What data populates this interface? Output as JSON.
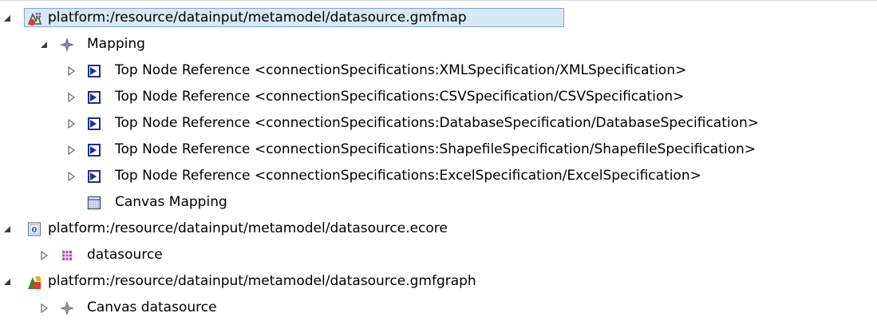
{
  "tree": {
    "gmfmap": {
      "label": "platform:/resource/datainput/metamodel/datasource.gmfmap",
      "icon": "gmfmap-icon",
      "expanded": true,
      "selected": true,
      "mapping": {
        "label": "Mapping",
        "icon": "mapping-node-icon",
        "expanded": true,
        "children": [
          {
            "label": "Top Node Reference <connectionSpecifications:XMLSpecification/XMLSpecification>",
            "icon": "top-node-reference-icon",
            "expanded": false
          },
          {
            "label": "Top Node Reference <connectionSpecifications:CSVSpecification/CSVSpecification>",
            "icon": "top-node-reference-icon",
            "expanded": false
          },
          {
            "label": "Top Node Reference <connectionSpecifications:DatabaseSpecification/DatabaseSpecification>",
            "icon": "top-node-reference-icon",
            "expanded": false
          },
          {
            "label": "Top Node Reference <connectionSpecifications:ShapefileSpecification/ShapefileSpecification>",
            "icon": "top-node-reference-icon",
            "expanded": false
          },
          {
            "label": "Top Node Reference <connectionSpecifications:ExcelSpecification/ExcelSpecification>",
            "icon": "top-node-reference-icon",
            "expanded": false
          },
          {
            "label": "Canvas Mapping",
            "icon": "canvas-mapping-icon",
            "expanded": null
          }
        ]
      }
    },
    "ecore": {
      "label": "platform:/resource/datainput/metamodel/datasource.ecore",
      "icon": "ecore-icon",
      "expanded": true,
      "children": [
        {
          "label": "datasource",
          "icon": "epackage-icon",
          "expanded": false
        }
      ]
    },
    "gmfgraph": {
      "label": "platform:/resource/datainput/metamodel/datasource.gmfgraph",
      "icon": "gmfgraph-icon",
      "expanded": true,
      "children": [
        {
          "label": "Canvas datasource",
          "icon": "canvas-node-icon",
          "expanded": false
        }
      ]
    }
  },
  "colors": {
    "selection_fill": "#d9e8f7",
    "selection_border": "#7aa7d8",
    "twistie": "#555555"
  }
}
